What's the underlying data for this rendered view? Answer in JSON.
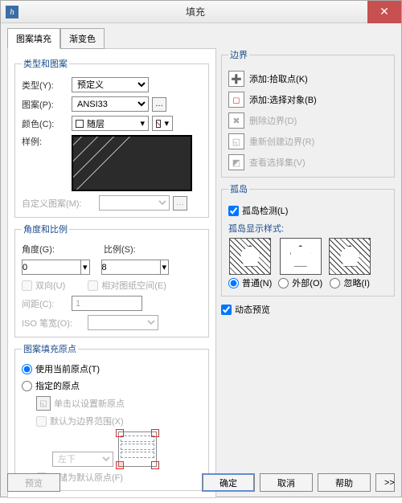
{
  "window": {
    "title": "填充"
  },
  "tabs": {
    "hatch": "图案填充",
    "gradient": "渐变色"
  },
  "type_pattern": {
    "legend": "类型和图案",
    "type_label": "类型(Y):",
    "type_value": "预定义",
    "pattern_label": "图案(P):",
    "pattern_value": "ANSI33",
    "color_label": "颜色(C):",
    "color_value": "随层",
    "sample_label": "样例:",
    "custom_label": "自定义图案(M):"
  },
  "angle_scale": {
    "legend": "角度和比例",
    "angle_label": "角度(G):",
    "angle_value": "0",
    "scale_label": "比例(S):",
    "scale_value": "8",
    "double_label": "双向(U)",
    "paper_label": "相对图纸空间(E)",
    "spacing_label": "间距(C):",
    "spacing_value": "1",
    "iso_label": "ISO 笔宽(O):"
  },
  "origin": {
    "legend": "图案填充原点",
    "use_current": "使用当前原点(T)",
    "specified": "指定的原点",
    "click_new": "单击以设置新原点",
    "default_bound": "默认为边界范围(X)",
    "pos_value": "左下",
    "store_default": "存储为默认原点(F)"
  },
  "boundary": {
    "legend": "边界",
    "add_pick": "添加:拾取点(K)",
    "add_select": "添加:选择对象(B)",
    "remove": "删除边界(D)",
    "recreate": "重新创建边界(R)",
    "view_sel": "查看选择集(V)"
  },
  "islands": {
    "legend": "孤岛",
    "detect": "孤岛检测(L)",
    "style_label": "孤岛显示样式:",
    "normal": "普通(N)",
    "outer": "外部(O)",
    "ignore": "忽略(I)"
  },
  "dynamic_preview": "动态预览",
  "footer": {
    "preview": "预览",
    "ok": "确定",
    "cancel": "取消",
    "help": "帮助",
    "more": ">>"
  }
}
